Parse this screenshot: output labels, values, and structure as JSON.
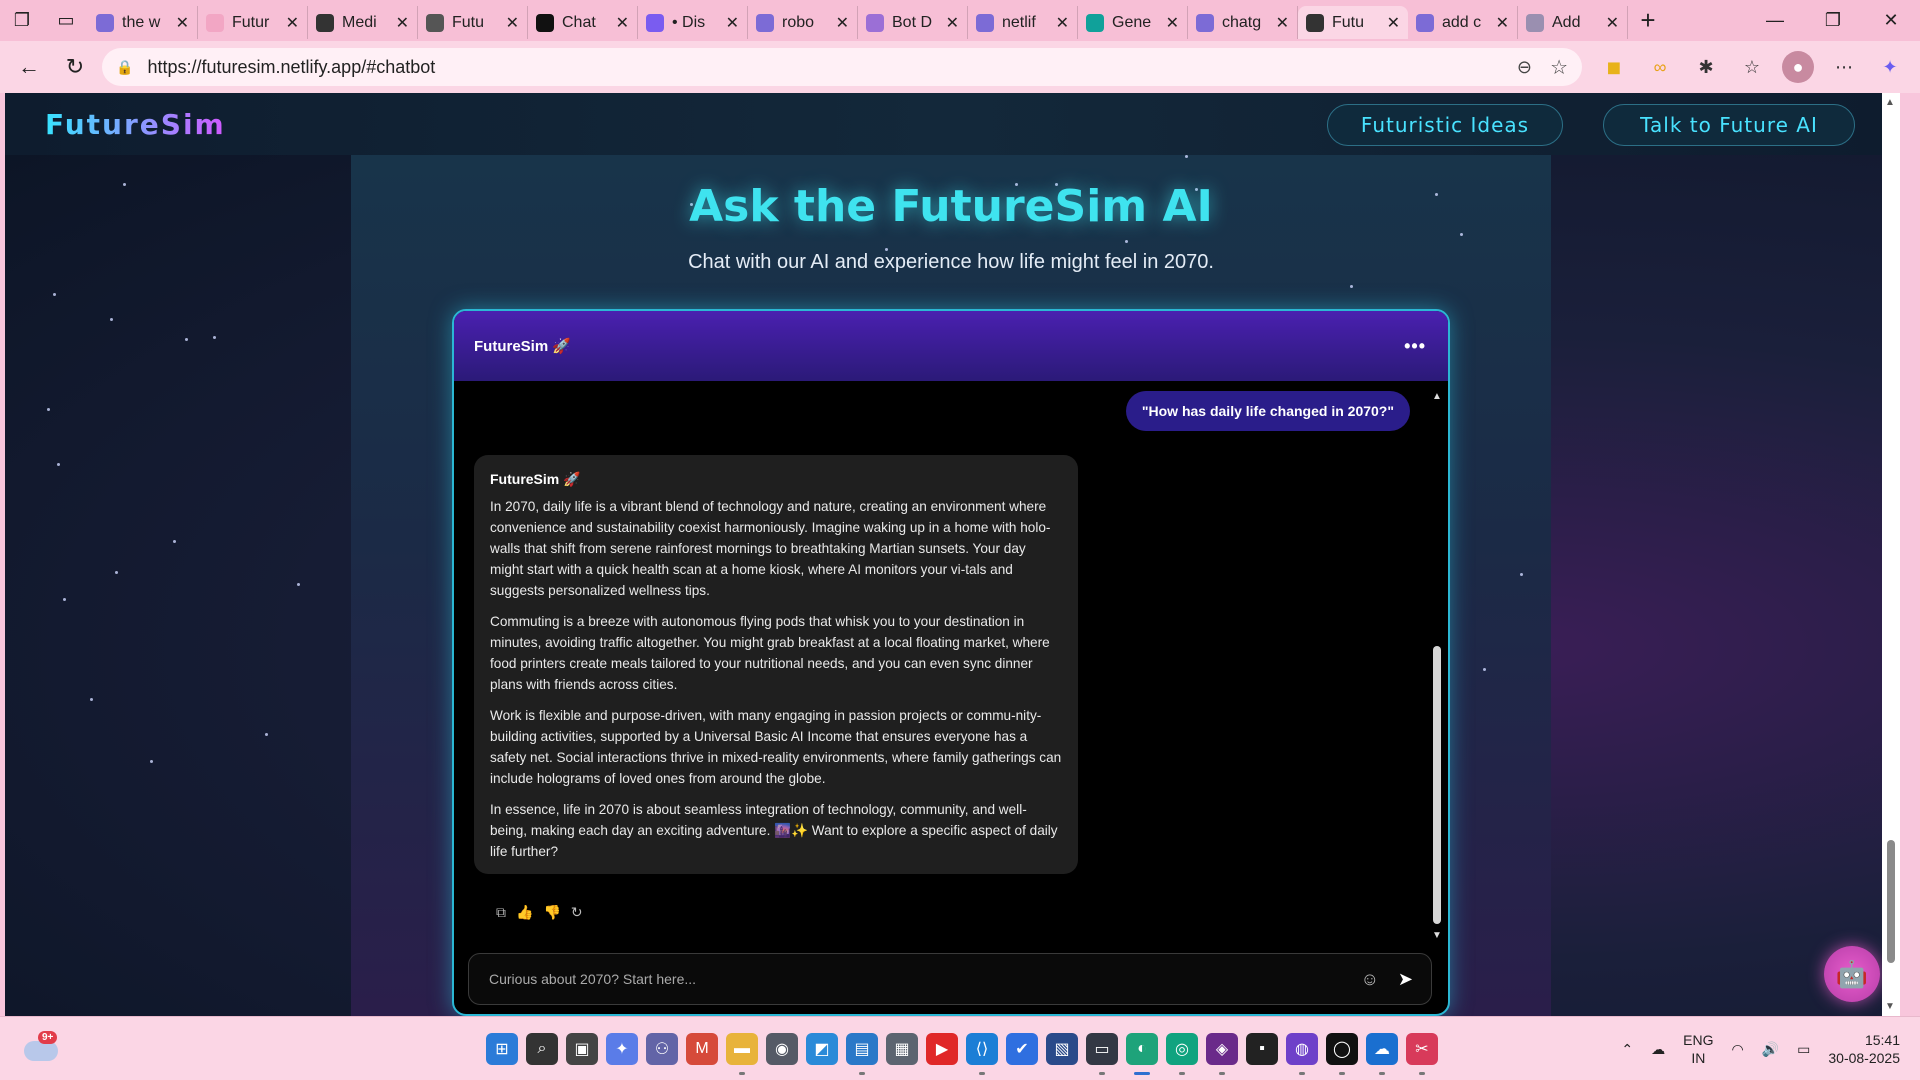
{
  "browser": {
    "tabs": [
      {
        "title": "the w",
        "favicon": "search-icon",
        "color": "#7c6bd6"
      },
      {
        "title": "Futur",
        "favicon": "pink-dot-icon",
        "color": "#f2a6c4"
      },
      {
        "title": "Medi",
        "favicon": "medium-icon",
        "color": "#333333"
      },
      {
        "title": "Futu",
        "favicon": "globe-icon",
        "color": "#555555"
      },
      {
        "title": "Chat",
        "favicon": "chat-app-icon",
        "color": "#111111"
      },
      {
        "title": "• Dis",
        "favicon": "discord-icon",
        "color": "#7a5cf0"
      },
      {
        "title": "robo",
        "favicon": "search-icon",
        "color": "#7c6bd6"
      },
      {
        "title": "Bot D",
        "favicon": "grid-icon",
        "color": "#9b6fd6"
      },
      {
        "title": "netlif",
        "favicon": "search-icon",
        "color": "#7c6bd6"
      },
      {
        "title": "Gene",
        "favicon": "diamond-icon",
        "color": "#10a19a"
      },
      {
        "title": "chatg",
        "favicon": "search-icon",
        "color": "#7c6bd6"
      },
      {
        "title": "Futu",
        "favicon": "globe-icon",
        "color": "#333333"
      },
      {
        "title": "add c",
        "favicon": "search-icon",
        "color": "#7c6bd6"
      },
      {
        "title": "Add",
        "favicon": "play-icon",
        "color": "#9a8fb0"
      }
    ],
    "active_tab_index": 11,
    "url": "https://futuresim.netlify.app/#chatbot"
  },
  "site": {
    "logo": "FutureSim",
    "nav": [
      "Futuristic Ideas",
      "Talk to Future AI"
    ],
    "hero_title": "Ask the FutureSim AI",
    "hero_subtitle": "Chat with our AI and experience how life might feel in 2070."
  },
  "chat": {
    "header_title": "FutureSim 🚀",
    "menu_icon": "•••",
    "user_message": "\"How has daily life changed in 2070?\"",
    "bot_name": "FutureSim 🚀",
    "bot_paragraphs": [
      "In 2070, daily life is a vibrant blend of technology and nature, creating an environment where convenience and sustainability coexist harmoniously. Imagine waking up in a home with holo-walls that shift from serene rainforest mornings to breathtaking Martian sunsets. Your day might start with a quick health scan at a home kiosk, where AI monitors your vi-tals and suggests personalized wellness tips.",
      "Commuting is a breeze with autonomous flying pods that whisk you to your destination in minutes, avoiding traffic altogether. You might grab breakfast at a local floating market, where food printers create meals tailored to your nutritional needs, and you can even sync dinner plans with friends across cities.",
      "Work is flexible and purpose-driven, with many engaging in passion projects or commu-nity-building activities, supported by a Universal Basic AI Income that ensures everyone has a safety net. Social interactions thrive in mixed-reality environments, where family gatherings can include holograms of loved ones from around the globe.",
      "In essence, life in 2070 is about seamless integration of technology, community, and well-being, making each day an exciting adventure. 🌆✨ Want to explore a specific aspect of daily life further?"
    ],
    "input_placeholder": "Curious about 2070? Start here..."
  },
  "taskbar": {
    "weather_badge": "9+",
    "lang_line1": "ENG",
    "lang_line2": "IN",
    "time": "15:41",
    "date": "30-08-2025",
    "apps": [
      {
        "name": "start-icon",
        "color": "#2b7bd8"
      },
      {
        "name": "search-icon",
        "color": "#333333"
      },
      {
        "name": "task-view-icon",
        "color": "#444444"
      },
      {
        "name": "copilot-icon",
        "color": "#5a7ce8"
      },
      {
        "name": "teams-icon",
        "color": "#6264a7"
      },
      {
        "name": "gmail-icon",
        "color": "#d64a3a"
      },
      {
        "name": "file-explorer-icon",
        "color": "#e8b33a"
      },
      {
        "name": "camera-icon",
        "color": "#555a66"
      },
      {
        "name": "photos-icon",
        "color": "#2a8ad8"
      },
      {
        "name": "notepad-icon",
        "color": "#2a78c8"
      },
      {
        "name": "calculator-icon",
        "color": "#5c6470"
      },
      {
        "name": "youtube-icon",
        "color": "#e02828"
      },
      {
        "name": "vscode-icon",
        "color": "#1c7ed6"
      },
      {
        "name": "todo-icon",
        "color": "#2f6fe0"
      },
      {
        "name": "blueprint-icon",
        "color": "#2a4a8a"
      },
      {
        "name": "terminal-icon",
        "color": "#333844"
      },
      {
        "name": "edge-icon",
        "color": "#1ea37a"
      },
      {
        "name": "chatgpt-icon",
        "color": "#10a37f"
      },
      {
        "name": "game-icon",
        "color": "#6a2a8a"
      },
      {
        "name": "console-icon",
        "color": "#222222"
      },
      {
        "name": "github-desktop-icon",
        "color": "#6e40c9"
      },
      {
        "name": "github-icon",
        "color": "#111111"
      },
      {
        "name": "onedrive-icon",
        "color": "#1a6fd0"
      },
      {
        "name": "snipping-icon",
        "color": "#d83a5a"
      }
    ]
  }
}
